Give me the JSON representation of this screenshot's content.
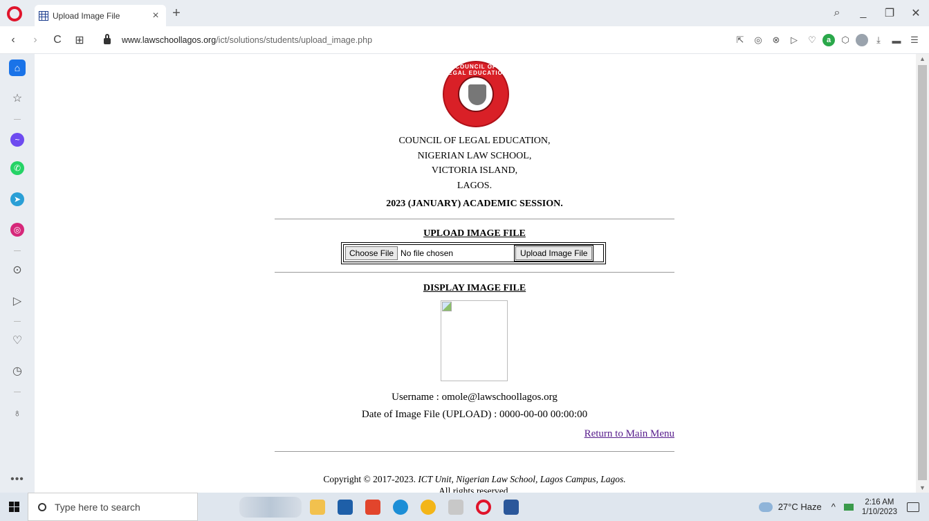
{
  "browser": {
    "tab_title": "Upload Image File",
    "tab_close": "×",
    "new_tab": "+",
    "url_host": "www.lawschoollagos.org",
    "url_path": "/ict/solutions/students/upload_image.php",
    "win_minimize": "_",
    "win_restore": "❐",
    "win_close": "✕",
    "search_glyph": "⌕",
    "nav": {
      "back": "‹",
      "forward": "›",
      "reload": "C",
      "grid": "⊞"
    }
  },
  "page": {
    "address_lines": [
      "COUNCIL OF LEGAL EDUCATION,",
      "NIGERIAN LAW SCHOOL,",
      "VICTORIA ISLAND,",
      "LAGOS."
    ],
    "session": "2023 (JANUARY) ACADEMIC SESSION.",
    "upload_title": "UPLOAD IMAGE FILE",
    "choose_file_label": "Choose File",
    "no_file_text": "No file chosen",
    "upload_button_label": "Upload Image File",
    "display_title": "DISPLAY IMAGE FILE",
    "username_line": "Username : omole@lawschoollagos.org",
    "date_line": "Date of Image File (UPLOAD) : 0000-00-00 00:00:00",
    "return_link": "Return to Main Menu",
    "footer_prefix": "Copyright © 2017-2023. ",
    "footer_italic": "ICT Unit, Nigerian Law School, Lagos Campus, Lagos.",
    "footer_line2": "All rights reserved."
  },
  "taskbar": {
    "search_placeholder": "Type here to search",
    "weather": "27°C  Haze",
    "tray_chevron": "^",
    "time": "2:16 AM",
    "date": "1/10/2023"
  },
  "colors": {
    "accent": "#1a73e8",
    "logo_red": "#d92027",
    "link_visited": "#551a8b"
  }
}
